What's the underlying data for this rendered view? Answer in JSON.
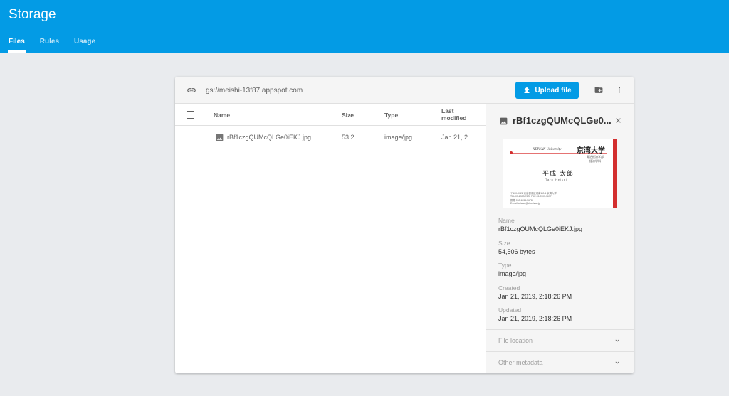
{
  "app": {
    "title": "Storage"
  },
  "tabs": [
    {
      "label": "Files",
      "active": true
    },
    {
      "label": "Rules",
      "active": false
    },
    {
      "label": "Usage",
      "active": false
    }
  ],
  "colors": {
    "brand": "#039be5",
    "accent_red": "#d32f2f"
  },
  "toolbar": {
    "bucket_path": "gs://meishi-13f87.appspot.com",
    "upload_label": "Upload file",
    "icons": [
      "link-icon",
      "upload-icon",
      "create-folder-icon",
      "more-vert-icon"
    ]
  },
  "table": {
    "columns": {
      "name": "Name",
      "size": "Size",
      "type": "Type",
      "modified_line1": "Last",
      "modified_line2": "modified"
    },
    "rows": [
      {
        "name": "rBf1czgQUMcQLGe0iEKJ.jpg",
        "size": "53.2...",
        "type": "image/jpg",
        "modified": "Jan 21, 2..."
      }
    ]
  },
  "detail": {
    "title": "rBf1czgQUMcQLGe0...",
    "preview": {
      "university_en": "KEIWAN University",
      "university_jp": "京湾大学",
      "dept_line1": "政治経済学部",
      "dept_line2": "経済学科",
      "name_jp": "平成 太郎",
      "name_en": "Taro Heisei",
      "address_lines": [
        "〒100-0022 東京都港区港南1-2-4 京湾大学",
        "TEL 03-2303-7678 FAX 03-2303-7677",
        "携帯 090-1234-5678",
        "E-mail keiwan@ki-univ.ac.jp"
      ]
    },
    "fields": [
      {
        "label": "Name",
        "value": "rBf1czgQUMcQLGe0iEKJ.jpg"
      },
      {
        "label": "Size",
        "value": "54,506 bytes"
      },
      {
        "label": "Type",
        "value": "image/jpg"
      },
      {
        "label": "Created",
        "value": "Jan 21, 2019, 2:18:26 PM"
      },
      {
        "label": "Updated",
        "value": "Jan 21, 2019, 2:18:26 PM"
      }
    ],
    "sections": [
      {
        "label": "File location"
      },
      {
        "label": "Other metadata"
      }
    ]
  }
}
